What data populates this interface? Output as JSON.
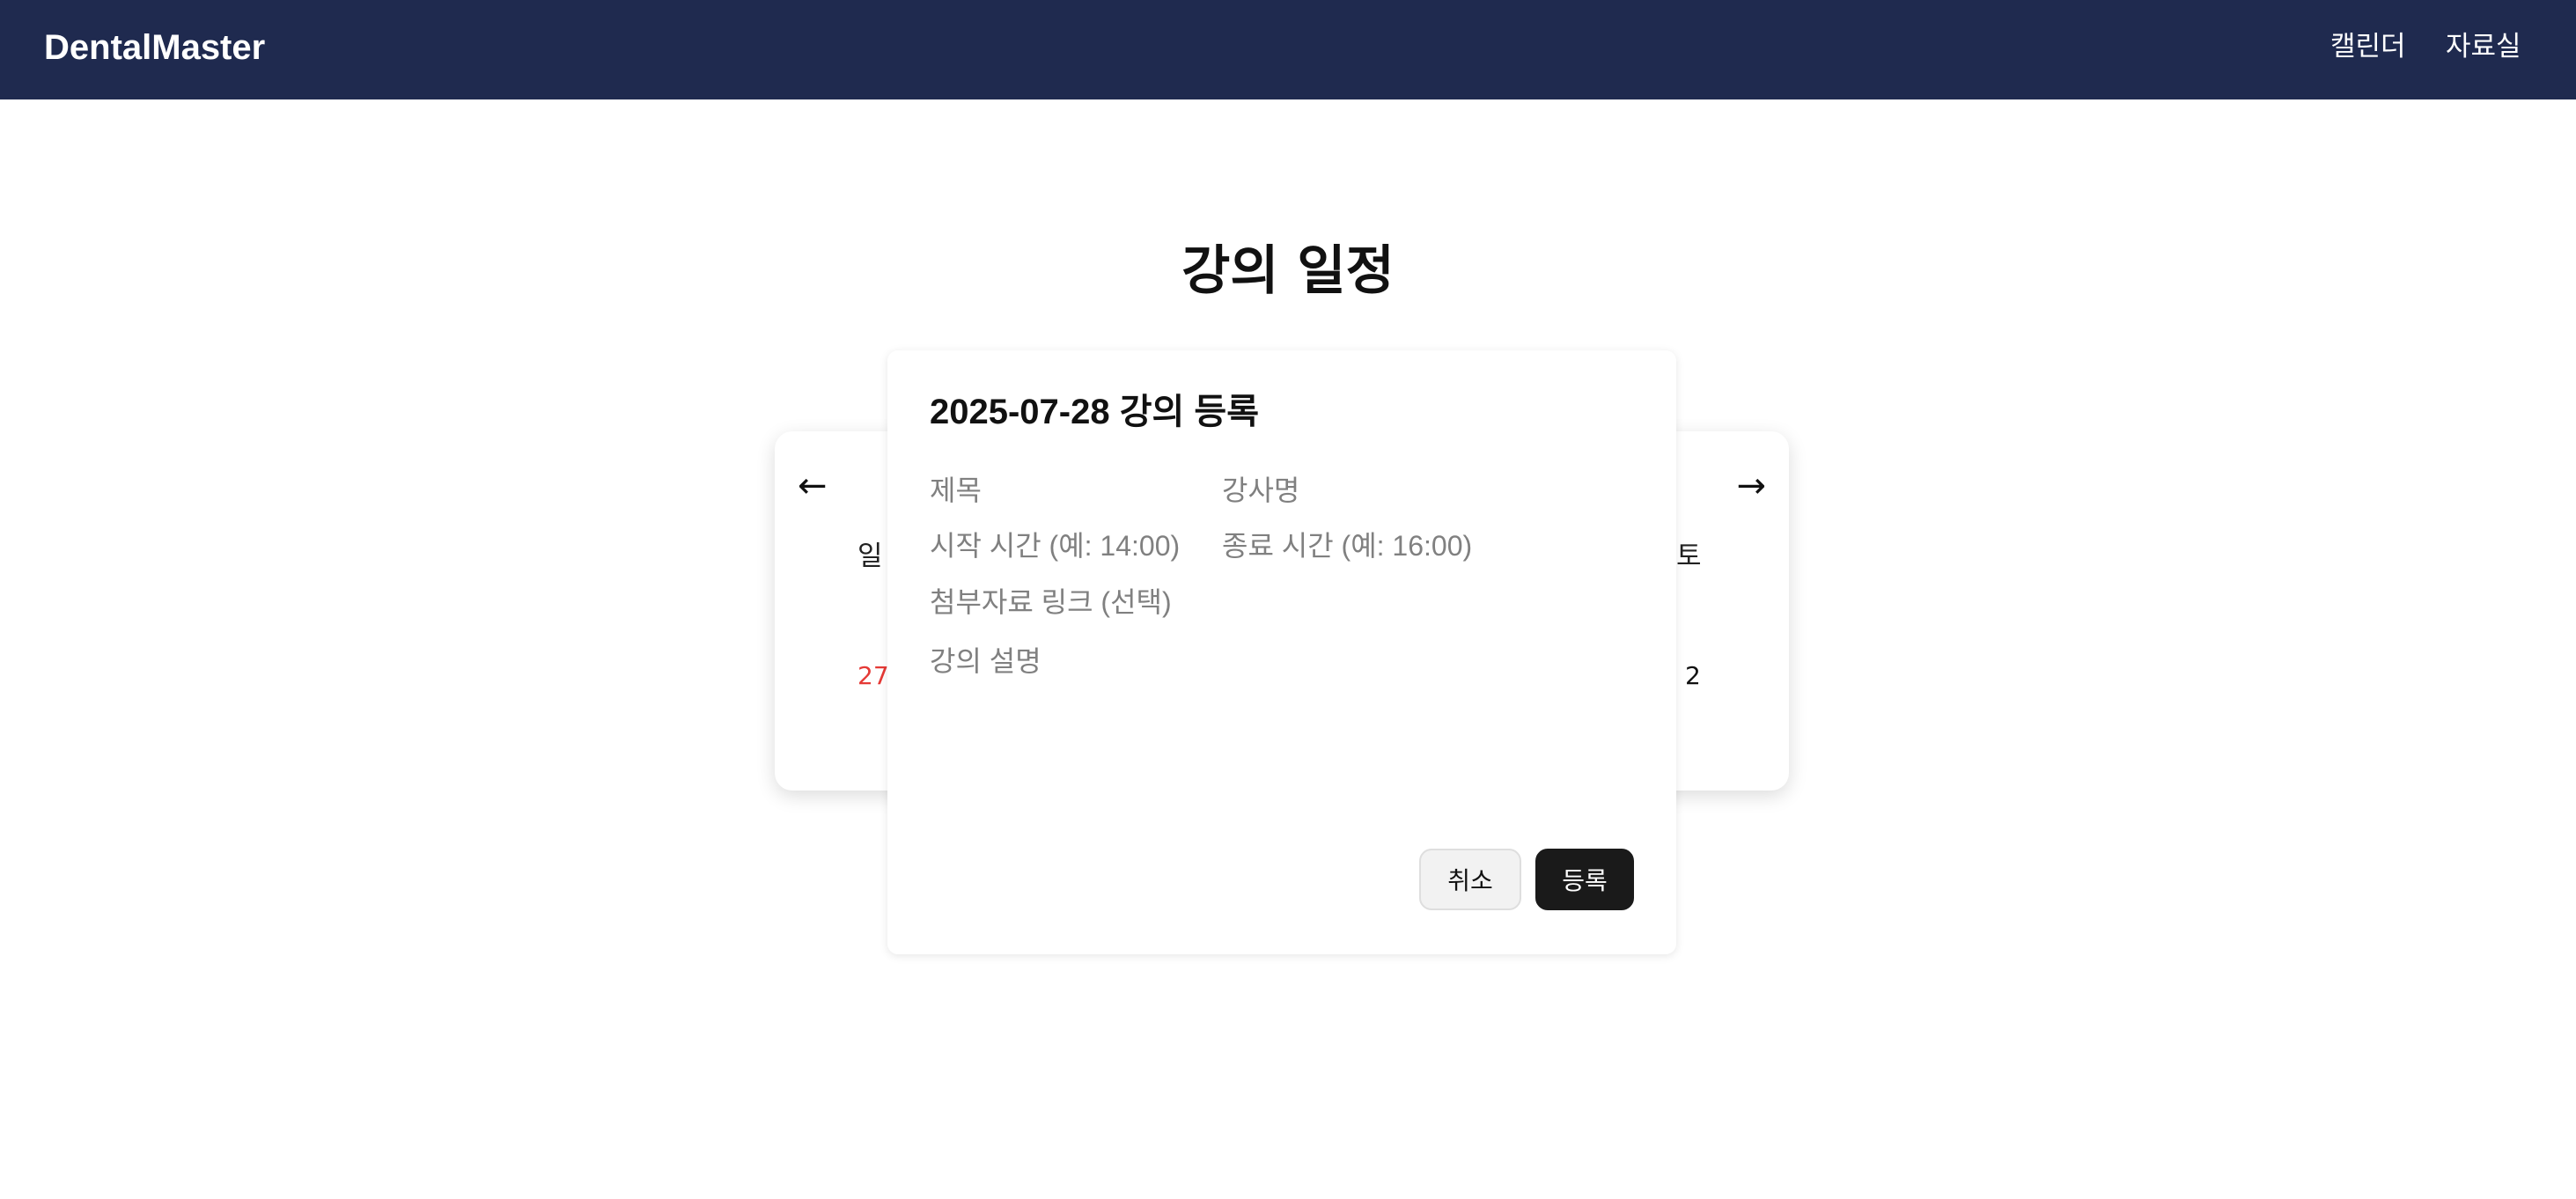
{
  "header": {
    "brand": "DentalMaster",
    "nav": {
      "calendar_label": "캘린더",
      "files_label": "자료실"
    }
  },
  "page": {
    "title": "강의 일정"
  },
  "calendar": {
    "prev_arrow": "←",
    "next_arrow": "→",
    "weekdays": {
      "sunday": "일",
      "saturday": "토"
    },
    "visible_days": {
      "first": "27",
      "last": "2"
    }
  },
  "modal": {
    "title": "2025-07-28 강의 등록",
    "fields": {
      "title_placeholder": "제목",
      "instructor_placeholder": "강사명",
      "start_time_placeholder": "시작 시간 (예: 14:00)",
      "end_time_placeholder": "종료 시간 (예: 16:00)",
      "attachment_placeholder": "첨부자료 링크 (선택)",
      "description_placeholder": "강의 설명"
    },
    "buttons": {
      "cancel_label": "취소",
      "submit_label": "등록"
    }
  },
  "colors": {
    "header_bg": "#1f2a4f",
    "sunday_red": "#e53935",
    "primary_button": "#1a1a1a"
  }
}
